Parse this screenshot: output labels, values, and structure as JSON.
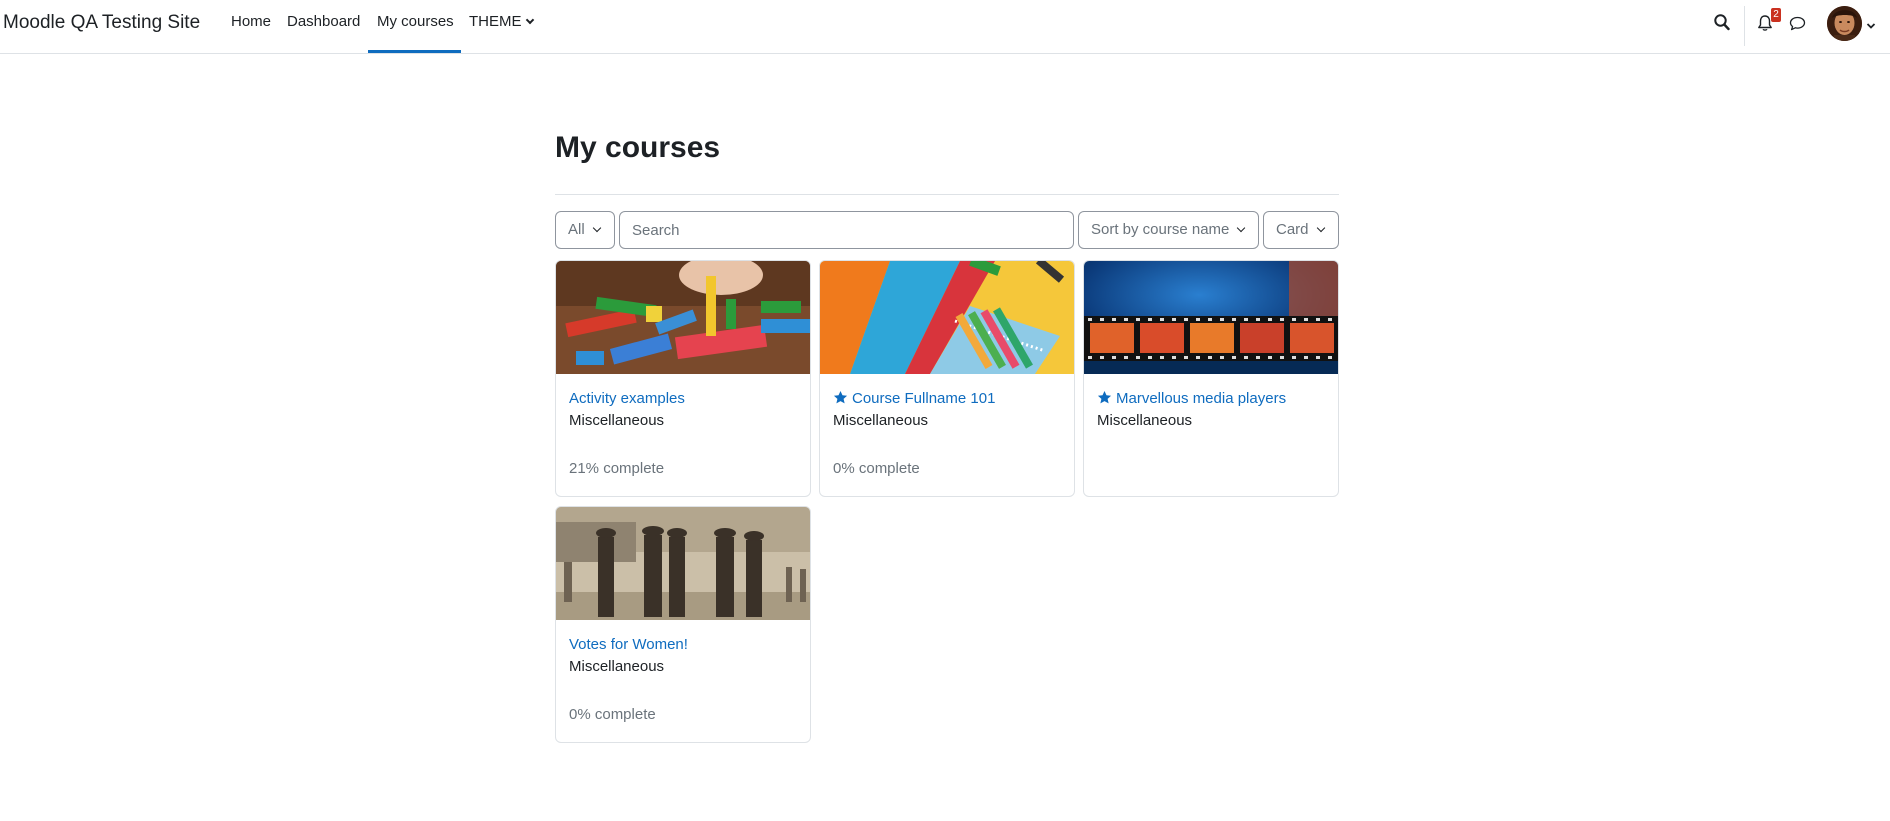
{
  "site": {
    "name": "Moodle QA Testing Site"
  },
  "nav": {
    "items": [
      {
        "label": "Home"
      },
      {
        "label": "Dashboard"
      },
      {
        "label": "My courses"
      },
      {
        "label": "THEME"
      }
    ],
    "active": "My courses",
    "notification_count": "2",
    "accent_color": "#0f6cbf"
  },
  "icons": {
    "search": "search-icon",
    "notifications": "bell-icon",
    "messages": "chat-bubble-icon",
    "user_menu": "avatar"
  },
  "page": {
    "title": "My courses"
  },
  "filters": {
    "grouping": "All",
    "search_placeholder": "Search",
    "search_value": "",
    "sort": "Sort by course name",
    "view": "Card"
  },
  "courses": [
    {
      "name": "Activity examples",
      "category": "Miscellaneous",
      "starred": false,
      "progress": "21% complete",
      "image": "colorful-wooden-blocks"
    },
    {
      "name": "Course Fullname 101",
      "category": "Miscellaneous",
      "starred": true,
      "progress": "0% complete",
      "image": "colored-paper-and-pens"
    },
    {
      "name": "Marvellous media players",
      "category": "Miscellaneous",
      "starred": true,
      "progress": "",
      "image": "film-strip-sunset"
    },
    {
      "name": "Votes for Women!",
      "category": "Miscellaneous",
      "starred": false,
      "progress": "0% complete",
      "image": "historic-suffragettes-photo"
    }
  ]
}
